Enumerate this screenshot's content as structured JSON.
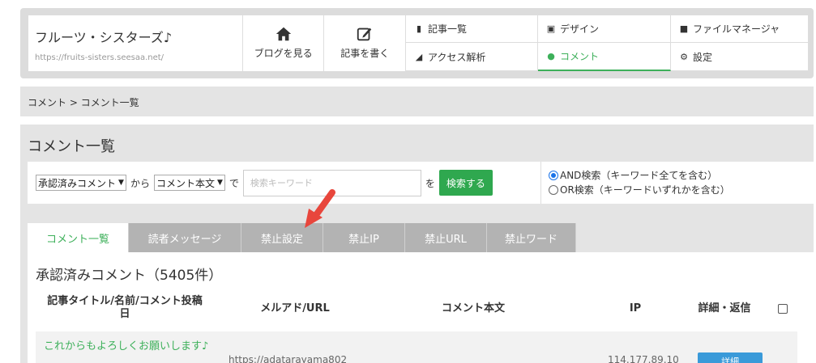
{
  "header": {
    "blog_name": "フルーツ・シスターズ♪",
    "blog_url": "https://fruits-sisters.seesaa.net/",
    "view_blog": "ブログを見る",
    "write_article": "記事を書く",
    "nav": [
      {
        "label": "記事一覧",
        "icon": "article-list-icon"
      },
      {
        "label": "デザイン",
        "icon": "image-icon"
      },
      {
        "label": "ファイルマネージャ",
        "icon": "file-icon"
      },
      {
        "label": "アクセス解析",
        "icon": "area-chart-icon"
      },
      {
        "label": "コメント",
        "icon": "comment-icon"
      },
      {
        "label": "設定",
        "icon": "gear-icon"
      }
    ]
  },
  "breadcrumb": "コメント > コメント一覧",
  "panel_title": "コメント一覧",
  "search": {
    "status_select": "承認済みコメント",
    "from_word": "から",
    "field_select": "コメント本文",
    "de_word": "で",
    "keyword_placeholder": "検索キーワード",
    "wo_word": "を",
    "button": "検索する",
    "and_option": "AND検索（キーワード全てを含む）",
    "or_option": "OR検索（キーワードいずれかを含む）"
  },
  "tabs": [
    {
      "label": "コメント一覧",
      "active": true
    },
    {
      "label": "読者メッセージ",
      "active": false
    },
    {
      "label": "禁止設定",
      "active": false
    },
    {
      "label": "禁止IP",
      "active": false
    },
    {
      "label": "禁止URL",
      "active": false
    },
    {
      "label": "禁止ワード",
      "active": false
    }
  ],
  "list_title": "承認済みコメント（5405件）",
  "columns": {
    "title": "記事タイトル/名前/コメント投稿日",
    "mail": "メルアド/URL",
    "body": "コメント本文",
    "ip": "IP",
    "detail": "詳細・返信"
  },
  "rows": [
    {
      "title": "これからもよろしくお願いします♪",
      "url": "https://adatarayama802",
      "ip": "114.177.89.10",
      "button": "詳細"
    }
  ],
  "colors": {
    "accent_green": "#3db05a",
    "button_green": "#2fa84f",
    "button_blue": "#3a9ad9",
    "annotation_arrow": "#e8463c"
  }
}
